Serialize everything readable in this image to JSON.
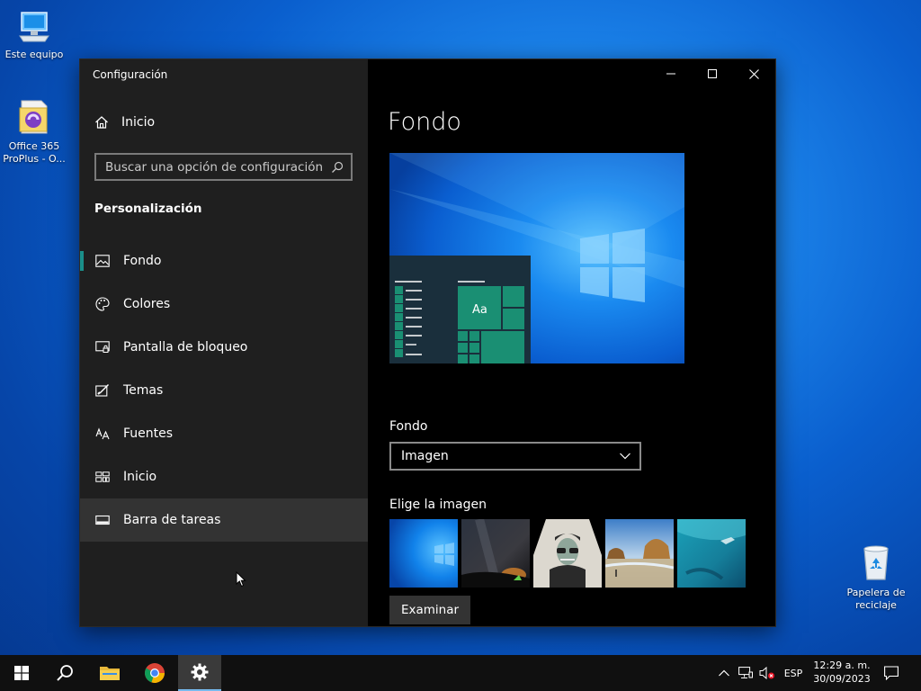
{
  "desktop": {
    "icons": [
      {
        "label": "Este equipo"
      },
      {
        "label": "Office 365 ProPlus - O..."
      },
      {
        "label": "Papelera de reciclaje"
      }
    ]
  },
  "window": {
    "title": "Configuración",
    "controls": {
      "minimize": "minimize",
      "maximize": "maximize",
      "close": "close"
    }
  },
  "sidebar": {
    "home_label": "Inicio",
    "search_placeholder": "Buscar una opción de configuración",
    "section_title": "Personalización",
    "items": [
      {
        "label": "Fondo",
        "icon": "picture-icon",
        "active": true
      },
      {
        "label": "Colores",
        "icon": "palette-icon"
      },
      {
        "label": "Pantalla de bloqueo",
        "icon": "lock-screen-icon"
      },
      {
        "label": "Temas",
        "icon": "themes-icon"
      },
      {
        "label": "Fuentes",
        "icon": "fonts-icon"
      },
      {
        "label": "Inicio",
        "icon": "start-layout-icon"
      },
      {
        "label": "Barra de tareas",
        "icon": "taskbar-icon",
        "hover": true
      }
    ]
  },
  "content": {
    "page_title": "Fondo",
    "preview_sample_text": "Aa",
    "background_label": "Fondo",
    "background_value": "Imagen",
    "choose_image_label": "Elige la imagen",
    "browse_label": "Examinar"
  },
  "taskbar": {
    "language": "ESP",
    "time": "12:29 a. m.",
    "date": "30/09/2023"
  },
  "colors": {
    "accent": "#1a8f8a",
    "sidebar_bg": "#1f1f1f",
    "content_bg": "#000000"
  }
}
